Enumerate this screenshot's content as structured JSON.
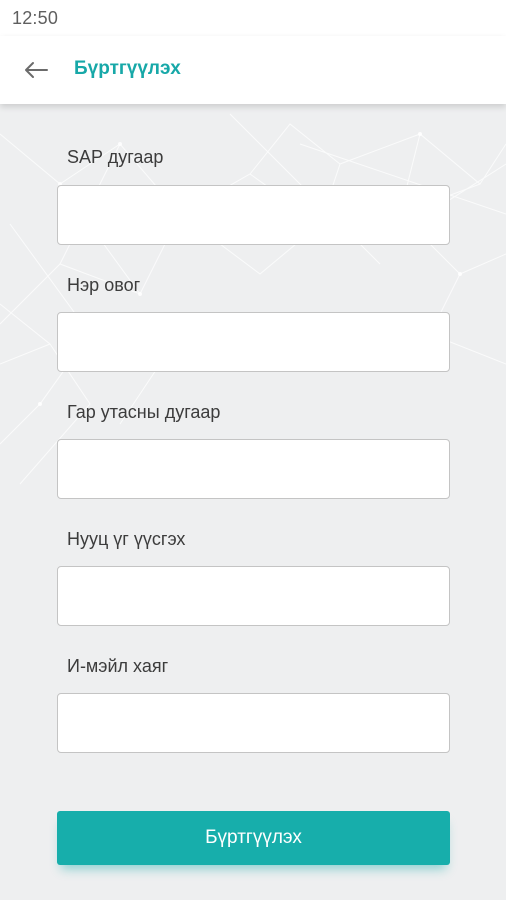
{
  "status_bar": {
    "time": "12:50"
  },
  "app_bar": {
    "back_icon": "arrow-left-icon",
    "title": "Бүртгүүлэх"
  },
  "form": {
    "fields": [
      {
        "label": "SAP дугаар",
        "value": ""
      },
      {
        "label": "Нэр овог",
        "value": ""
      },
      {
        "label": "Гар утасны дугаар",
        "value": ""
      },
      {
        "label": "Нууц үг үүсгэх",
        "value": ""
      },
      {
        "label": "И-мэйл хаяг",
        "value": ""
      }
    ],
    "submit_label": "Бүртгүүлэх"
  },
  "colors": {
    "accent": "#17aeab",
    "title": "#17a8a8",
    "background": "#eeeff0"
  }
}
